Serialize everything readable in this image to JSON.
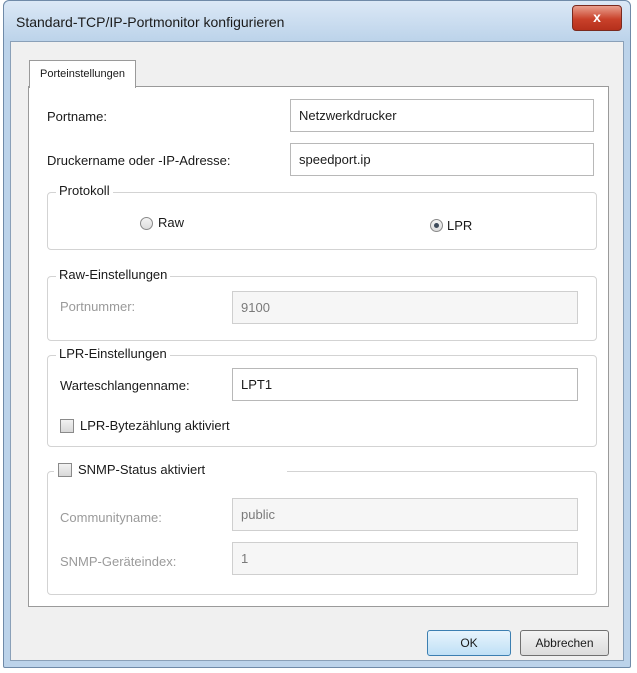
{
  "window": {
    "title": "Standard-TCP/IP-Portmonitor konfigurieren",
    "close_label": "x"
  },
  "tab": {
    "label": "Porteinstellungen"
  },
  "port": {
    "name_label": "Portname:",
    "name_value": "Netzwerkdrucker",
    "host_label": "Druckername oder -IP-Adresse:",
    "host_value": "speedport.ip"
  },
  "protocol": {
    "legend": "Protokoll",
    "raw_label": "Raw",
    "raw_selected": false,
    "lpr_label": "LPR",
    "lpr_selected": true
  },
  "raw_settings": {
    "legend": "Raw-Einstellungen",
    "port_label": "Portnummer:",
    "port_value": "9100"
  },
  "lpr_settings": {
    "legend": "LPR-Einstellungen",
    "queue_label": "Warteschlangenname:",
    "queue_value": "LPT1",
    "bytecount_label": "LPR-Bytezählung aktiviert",
    "bytecount_checked": false
  },
  "snmp": {
    "label": "SNMP-Status aktiviert",
    "checked": false,
    "community_label": "Communityname:",
    "community_value": "public",
    "index_label": "SNMP-Geräteindex:",
    "index_value": "1"
  },
  "buttons": {
    "ok": "OK",
    "cancel": "Abbrechen"
  }
}
